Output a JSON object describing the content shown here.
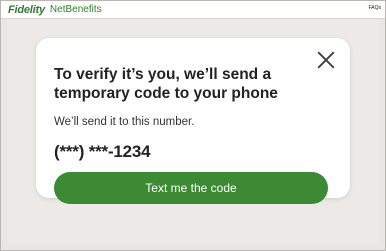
{
  "header": {
    "brand": "Fidelity",
    "product": "NetBenefits",
    "faq_link": "FAQs"
  },
  "dialog": {
    "title": "To verify it’s you, we’ll send a temporary code to your phone",
    "subtitle": "We’ll send it to this number.",
    "phone_number": "(***) ***-1234",
    "button_label": "Text me the code"
  },
  "colors": {
    "brand_green": "#2f7d32",
    "button_green": "#3c8a34",
    "background": "#ece9e6"
  }
}
